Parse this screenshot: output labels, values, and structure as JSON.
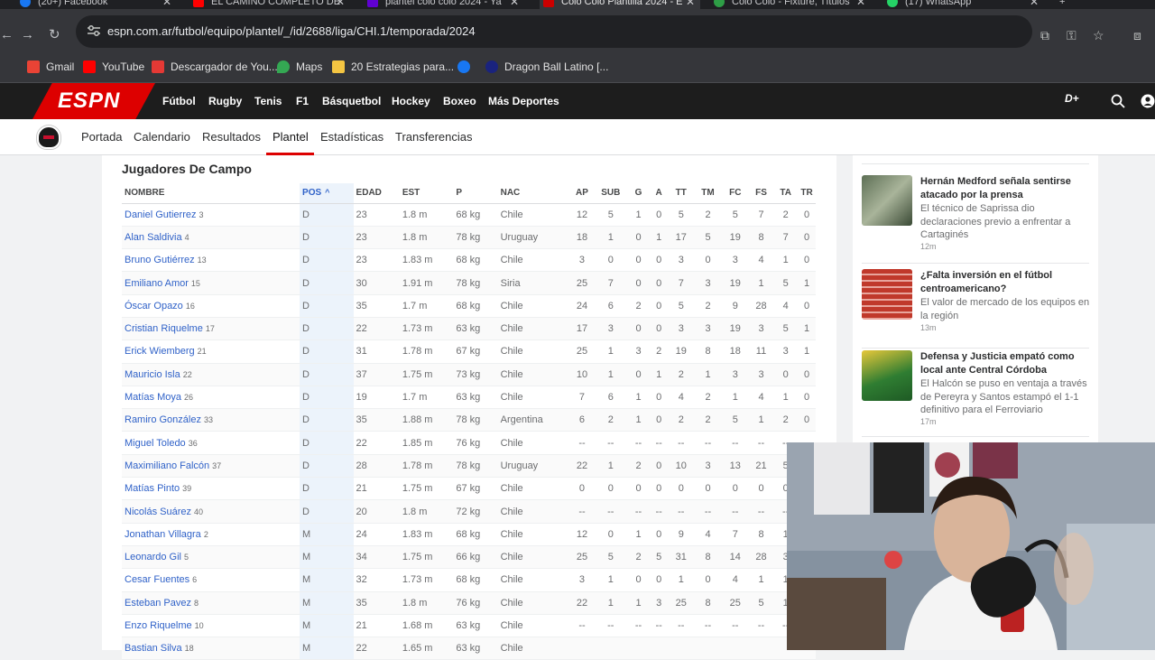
{
  "browser": {
    "tabs": [
      {
        "title": "(20+) Facebook",
        "color": "#1877f2"
      },
      {
        "title": "EL CAMINO COMPLETO DE",
        "color": "#ff0000"
      },
      {
        "title": "plantel colo colo 2024 - Ya",
        "color": "#6001d2"
      },
      {
        "title": "Colo Colo Plantilla 2024 - E",
        "color": "#cc0000"
      },
      {
        "title": "Colo Colo - Fixture, Títulos",
        "color": "#2e9e46"
      },
      {
        "title": "(17) WhatsApp",
        "color": "#25d366"
      }
    ],
    "url": "espn.com.ar/futbol/equipo/plantel/_/id/2688/liga/CHI.1/temporada/2024",
    "bookmarks": [
      {
        "label": "Gmail",
        "color": "#ea4335"
      },
      {
        "label": "YouTube",
        "color": "#ff0000"
      },
      {
        "label": "Descargador de You...",
        "color": "#e53935"
      },
      {
        "label": "Maps",
        "color": "#34a853"
      },
      {
        "label": "20 Estrategias para...",
        "color": "#f4c542"
      },
      {
        "label": "",
        "color": "#1877f2"
      },
      {
        "label": "Dragon Ball Latino [...",
        "color": "#1a237e"
      }
    ]
  },
  "espn": {
    "logo": "ESPN",
    "nav": [
      "Fútbol",
      "Rugby",
      "Tenis",
      "F1",
      "Básquetbol",
      "Hockey",
      "Boxeo",
      "Más Deportes"
    ],
    "subnav": [
      "Portada",
      "Calendario",
      "Resultados",
      "Plantel",
      "Estadísticas",
      "Transferencias"
    ]
  },
  "roster": {
    "section_title": "Jugadores De Campo",
    "columns": [
      "NOMBRE",
      "POS",
      "EDAD",
      "EST",
      "P",
      "NAC",
      "AP",
      "SUB",
      "G",
      "A",
      "TT",
      "TM",
      "FC",
      "FS",
      "TA",
      "TR"
    ],
    "sort_indicator": "^",
    "rows": [
      [
        "Daniel Gutierrez",
        "3",
        "D",
        "23",
        "1.8 m",
        "68 kg",
        "Chile",
        "12",
        "5",
        "1",
        "0",
        "5",
        "2",
        "5",
        "7",
        "2",
        "0"
      ],
      [
        "Alan Saldivia",
        "4",
        "D",
        "23",
        "1.8 m",
        "78 kg",
        "Uruguay",
        "18",
        "1",
        "0",
        "1",
        "17",
        "5",
        "19",
        "8",
        "7",
        "0"
      ],
      [
        "Bruno Gutiérrez",
        "13",
        "D",
        "23",
        "1.83 m",
        "68 kg",
        "Chile",
        "3",
        "0",
        "0",
        "0",
        "3",
        "0",
        "3",
        "4",
        "1",
        "0"
      ],
      [
        "Emiliano Amor",
        "15",
        "D",
        "30",
        "1.91 m",
        "78 kg",
        "Siria",
        "25",
        "7",
        "0",
        "0",
        "7",
        "3",
        "19",
        "1",
        "5",
        "1"
      ],
      [
        "Óscar Opazo",
        "16",
        "D",
        "35",
        "1.7 m",
        "68 kg",
        "Chile",
        "24",
        "6",
        "2",
        "0",
        "5",
        "2",
        "9",
        "28",
        "4",
        "0"
      ],
      [
        "Cristian Riquelme",
        "17",
        "D",
        "22",
        "1.73 m",
        "63 kg",
        "Chile",
        "17",
        "3",
        "0",
        "0",
        "3",
        "3",
        "19",
        "3",
        "5",
        "1"
      ],
      [
        "Erick Wiemberg",
        "21",
        "D",
        "31",
        "1.78 m",
        "67 kg",
        "Chile",
        "25",
        "1",
        "3",
        "2",
        "19",
        "8",
        "18",
        "11",
        "3",
        "1"
      ],
      [
        "Mauricio Isla",
        "22",
        "D",
        "37",
        "1.75 m",
        "73 kg",
        "Chile",
        "10",
        "1",
        "0",
        "1",
        "2",
        "1",
        "3",
        "3",
        "0",
        "0"
      ],
      [
        "Matías Moya",
        "26",
        "D",
        "19",
        "1.7 m",
        "63 kg",
        "Chile",
        "7",
        "6",
        "1",
        "0",
        "4",
        "2",
        "1",
        "4",
        "1",
        "0"
      ],
      [
        "Ramiro González",
        "33",
        "D",
        "35",
        "1.88 m",
        "78 kg",
        "Argentina",
        "6",
        "2",
        "1",
        "0",
        "2",
        "2",
        "5",
        "1",
        "2",
        "0"
      ],
      [
        "Miguel Toledo",
        "36",
        "D",
        "22",
        "1.85 m",
        "76 kg",
        "Chile",
        "--",
        "--",
        "--",
        "--",
        "--",
        "--",
        "--",
        "--",
        "--",
        "--"
      ],
      [
        "Maximiliano Falcón",
        "37",
        "D",
        "28",
        "1.78 m",
        "78 kg",
        "Uruguay",
        "22",
        "1",
        "2",
        "0",
        "10",
        "3",
        "13",
        "21",
        "5",
        ""
      ],
      [
        "Matías Pinto",
        "39",
        "D",
        "21",
        "1.75 m",
        "67 kg",
        "Chile",
        "0",
        "0",
        "0",
        "0",
        "0",
        "0",
        "0",
        "0",
        "0",
        ""
      ],
      [
        "Nicolás Suárez",
        "40",
        "D",
        "20",
        "1.8 m",
        "72 kg",
        "Chile",
        "--",
        "--",
        "--",
        "--",
        "--",
        "--",
        "--",
        "--",
        "--",
        ""
      ],
      [
        "Jonathan Villagra",
        "2",
        "M",
        "24",
        "1.83 m",
        "68 kg",
        "Chile",
        "12",
        "0",
        "1",
        "0",
        "9",
        "4",
        "7",
        "8",
        "1",
        ""
      ],
      [
        "Leonardo Gil",
        "5",
        "M",
        "34",
        "1.75 m",
        "66 kg",
        "Chile",
        "25",
        "5",
        "2",
        "5",
        "31",
        "8",
        "14",
        "28",
        "3",
        ""
      ],
      [
        "Cesar Fuentes",
        "6",
        "M",
        "32",
        "1.73 m",
        "68 kg",
        "Chile",
        "3",
        "1",
        "0",
        "0",
        "1",
        "0",
        "4",
        "1",
        "1",
        ""
      ],
      [
        "Esteban Pavez",
        "8",
        "M",
        "35",
        "1.8 m",
        "76 kg",
        "Chile",
        "22",
        "1",
        "1",
        "3",
        "25",
        "8",
        "25",
        "5",
        "1",
        ""
      ],
      [
        "Enzo Riquelme",
        "10",
        "M",
        "21",
        "1.68 m",
        "63 kg",
        "Chile",
        "--",
        "--",
        "--",
        "--",
        "--",
        "--",
        "--",
        "--",
        "--",
        ""
      ],
      [
        "Bastian Silva",
        "18",
        "M",
        "22",
        "1.65 m",
        "63 kg",
        "Chile",
        "",
        "",
        "",
        "",
        "",
        "",
        "",
        "",
        "",
        ""
      ]
    ]
  },
  "sidebar": {
    "news": [
      {
        "title": "Hernán Medford señala sentirse atacado por la prensa",
        "desc": "El técnico de Saprissa dio declaraciones previo a enfrentar a Cartaginés",
        "time": "12m",
        "thumb": "#7a8a6a"
      },
      {
        "title": "¿Falta inversión en el fútbol centroamericano?",
        "desc": "El valor de mercado de los equipos en la región",
        "time": "13m",
        "thumb": "#c0392b"
      },
      {
        "title": "Defensa y Justicia empató como local ante Central Córdoba",
        "desc": "El Halcón se puso en ventaja a través de Pereyra y Santos estampó el 1-1 definitivo para el Ferroviario",
        "time": "17m",
        "thumb": "#4a8a3a"
      }
    ]
  }
}
